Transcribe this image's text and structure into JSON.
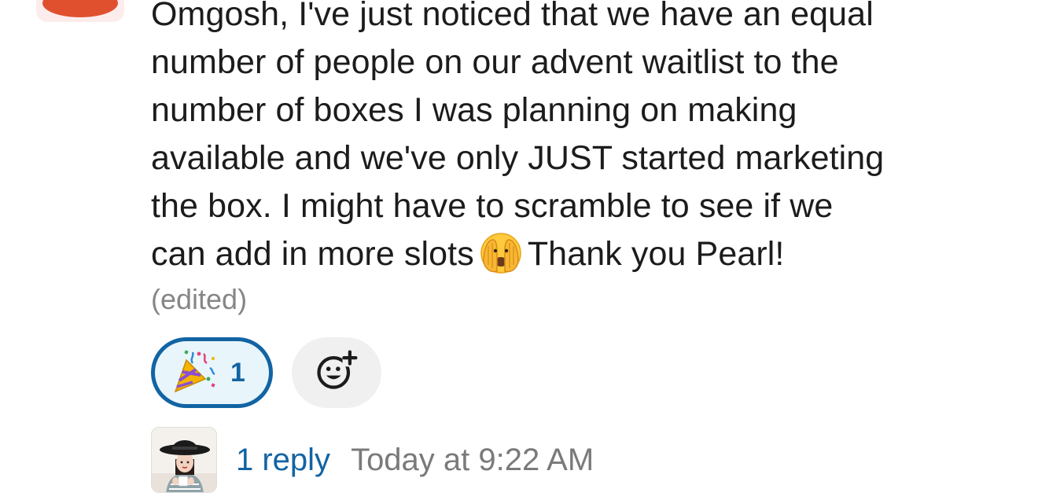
{
  "message": {
    "text_before_emoji": "Omgosh, I've just noticed that we have an equal\nnumber of people on our advent waitlist to the\nnumber of boxes I was planning on making\navailable and we've only JUST started marketing\nthe box. I might have to scramble to see if we\ncan add in more slots",
    "emoji": "face-with-hand-over-mouth-icon",
    "text_after_emoji": "Thank you Pearl!",
    "edited_label": "(edited)"
  },
  "reactions": [
    {
      "emoji": "party-popper-icon",
      "count": "1",
      "selected": true
    }
  ],
  "add_reaction_icon": "add-reaction-icon",
  "thread": {
    "reply_count_label": "1 reply",
    "timestamp": "Today at 9:22 AM"
  },
  "colors": {
    "link": "#1264a3",
    "reaction_bg": "#e8f5fa",
    "muted": "#868686",
    "avatar_red": "#e0502f"
  }
}
